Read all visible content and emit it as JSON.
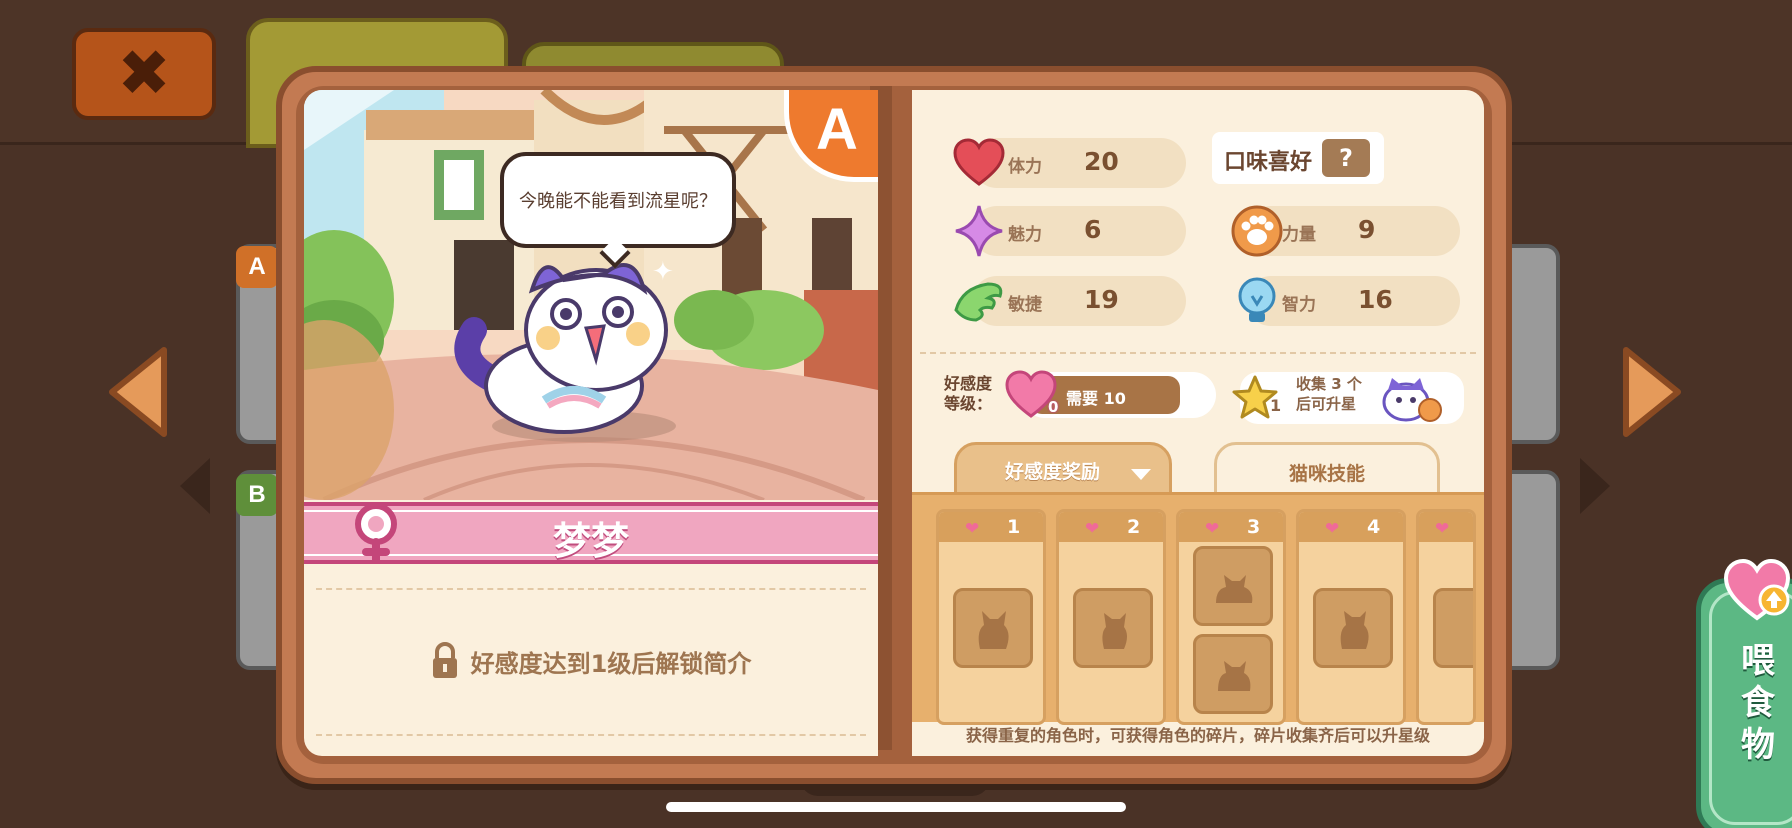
{
  "character": {
    "rank": "A",
    "name": "梦梦",
    "speech": "今晚能不能看到流星呢？",
    "locked_intro": "好感度达到1级后解锁简介"
  },
  "taste": {
    "label": "口味喜好",
    "value": "?"
  },
  "stats": [
    {
      "label": "体力",
      "value": "20",
      "icon": "heart-icon"
    },
    {
      "label": "魅力",
      "value": "6",
      "icon": "sparkle-icon"
    },
    {
      "label": "力量",
      "value": "9",
      "icon": "paw-icon"
    },
    {
      "label": "敏捷",
      "value": "19",
      "icon": "wing-icon"
    },
    {
      "label": "智力",
      "value": "16",
      "icon": "lightbulb-icon"
    }
  ],
  "favor": {
    "label": "好感度等级：",
    "level": "0",
    "need": "需要 10",
    "stars": "1",
    "star_text_line1": "收集 3 个",
    "star_text_line2": "后可升星"
  },
  "tabs": {
    "active": "好感度奖励",
    "inactive": "猫咪技能"
  },
  "rewards": [
    {
      "level": "1"
    },
    {
      "level": "2"
    },
    {
      "level": "3"
    },
    {
      "level": "4"
    }
  ],
  "footnote": "获得重复的角色时，可获得角色的碎片，碎片收集齐后可以升星级",
  "feed_button": "喂食物",
  "background": {
    "badge_a": "A",
    "badge_b": "B"
  },
  "colors": {
    "accent_orange": "#ee7a2e",
    "name_pink": "#f0a6c0",
    "feed_green": "#5cb884"
  }
}
